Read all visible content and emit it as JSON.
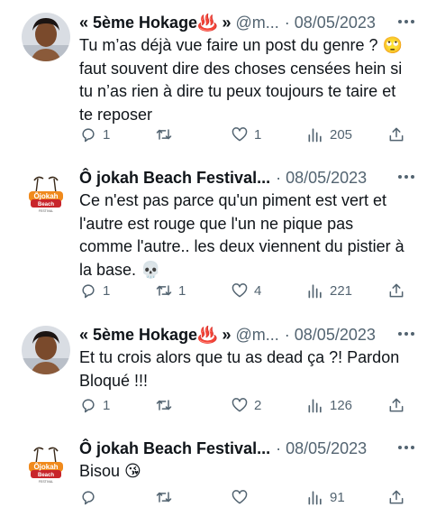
{
  "tweets": [
    {
      "name": "« 5ème Hokage♨️ »",
      "handle": "@m...",
      "date": "08/05/2023",
      "text": "Tu m’as déjà vue faire un post du genre ? 🙄 faut souvent dire des choses censées hein si tu n’as rien à dire tu peux toujours te taire et te reposer",
      "replies": "1",
      "retweets": "",
      "likes": "1",
      "views": "205"
    },
    {
      "name": "Ô jokah Beach Festival...",
      "handle": "",
      "date": "08/05/2023",
      "text": "Ce n'est pas parce qu'un piment est vert et l'autre est rouge que l'un ne pique pas comme l'autre.. les deux viennent du pistier à la base. 💀",
      "replies": "1",
      "retweets": "1",
      "likes": "4",
      "views": "221"
    },
    {
      "name": "« 5ème Hokage♨️ »",
      "handle": "@m...",
      "date": "08/05/2023",
      "text": "Et tu crois alors que tu as dead ça ?! Pardon Bloqué !!!",
      "replies": "1",
      "retweets": "",
      "likes": "2",
      "views": "126"
    },
    {
      "name": "Ô jokah Beach Festival...",
      "handle": "",
      "date": "08/05/2023",
      "text": "Bisou 😘",
      "replies": "",
      "retweets": "",
      "likes": "",
      "views": "91"
    }
  ],
  "separator": "·",
  "colors": {
    "text": "#0f1419",
    "muted": "#536471",
    "logo_orange": "#f08a1c",
    "logo_red": "#c8242a"
  },
  "icons": [
    "reply-icon",
    "retweet-icon",
    "like-icon",
    "views-icon",
    "share-icon",
    "more-icon"
  ]
}
